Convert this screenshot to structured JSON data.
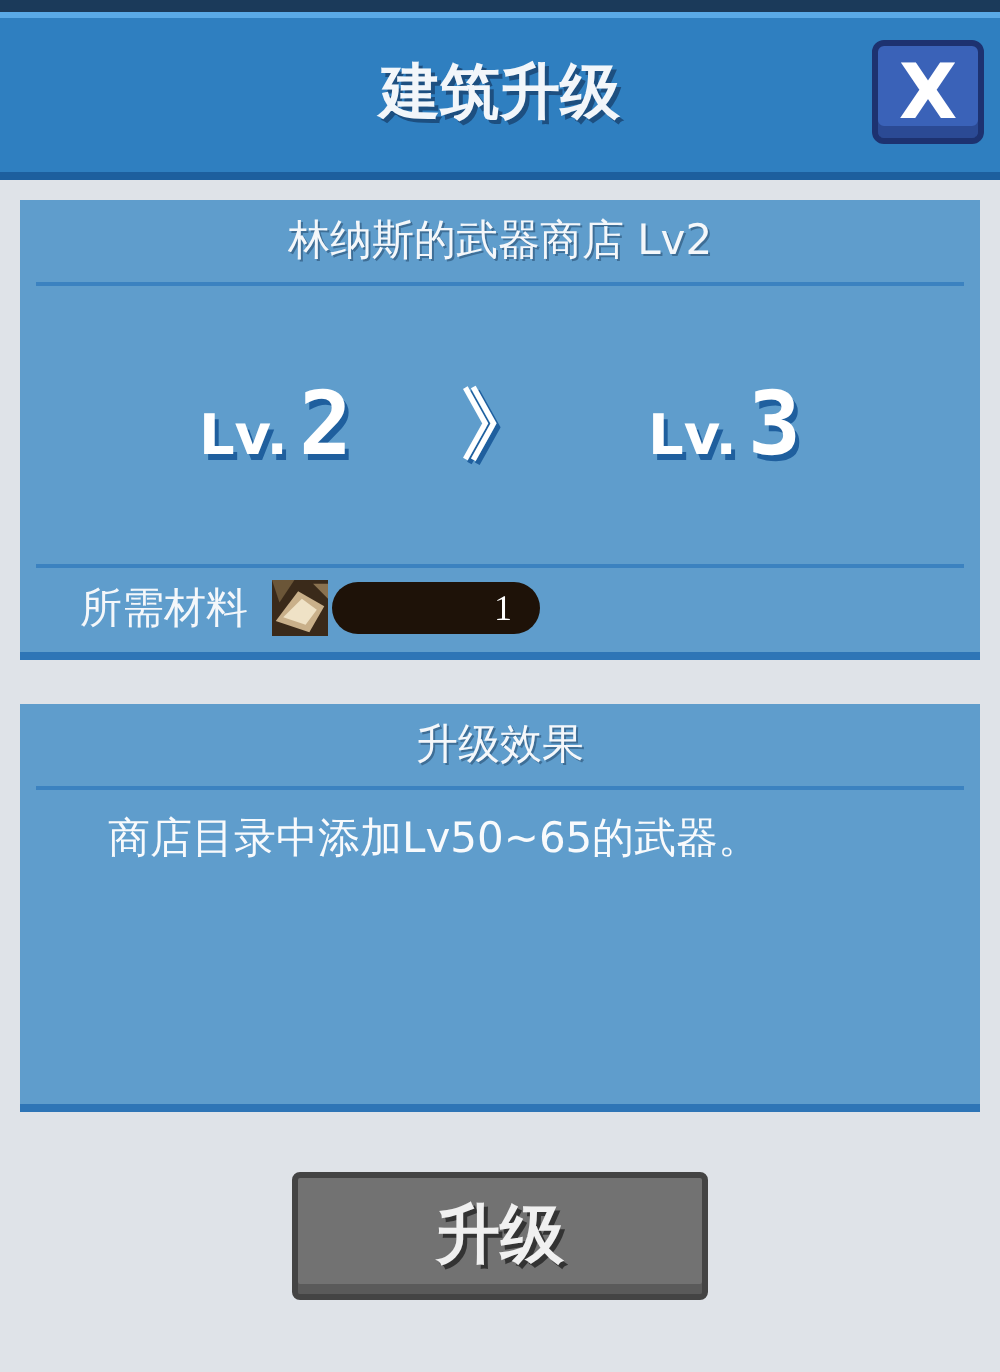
{
  "window": {
    "title": "建筑升级",
    "close": "X"
  },
  "building": {
    "name": "林纳斯的武器商店 Lv2",
    "current": {
      "prefix": "Lv.",
      "level": "2"
    },
    "arrow": "》",
    "next": {
      "prefix": "Lv.",
      "level": "3"
    }
  },
  "materials": {
    "label": "所需材料",
    "items": [
      {
        "kind": "picture",
        "count": "1"
      }
    ]
  },
  "effect": {
    "title": "升级效果",
    "text": "商店目录中添加Lv50~65的武器。"
  },
  "upgrade_button": {
    "label": "升级",
    "disabled": true
  }
}
